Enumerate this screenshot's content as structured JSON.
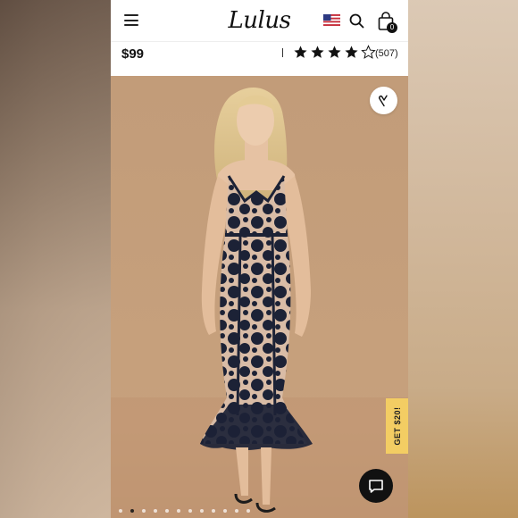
{
  "header": {
    "logo_text": "Lulus",
    "menu_icon": "hamburger-menu-icon",
    "flag_icon": "us-flag-icon",
    "search_icon": "search-icon",
    "bag_icon": "shopping-bag-icon",
    "bag_count": "0"
  },
  "product": {
    "price": "$99",
    "rating_stars": 4,
    "rating_max": 5,
    "review_count": "(507)"
  },
  "gallery": {
    "image_description_icon": "product-photo",
    "total_images": 12,
    "active_index": 1
  },
  "wishlist": {
    "icon": "heart-icon"
  },
  "promo": {
    "label": "GET $20!"
  },
  "chat": {
    "icon": "chat-bubble-icon"
  },
  "colors": {
    "accent_promo": "#f3cd63",
    "dress_navy": "#1c2236",
    "photo_background": "#c39d7b"
  }
}
